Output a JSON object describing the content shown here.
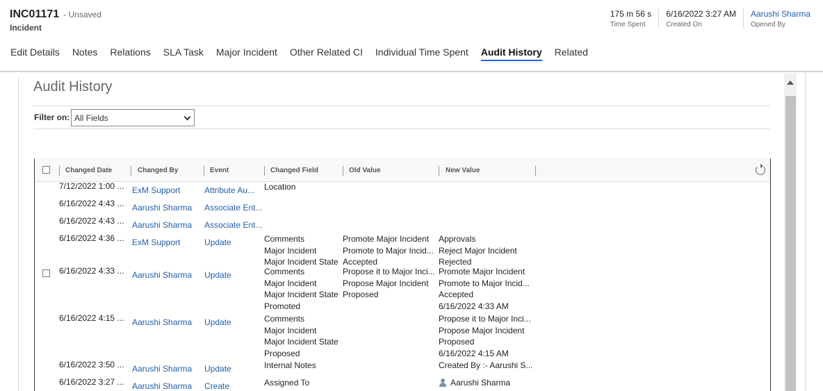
{
  "header": {
    "record_id": "INC01171",
    "save_status": "- Unsaved",
    "entity_type": "Incident",
    "fields": [
      {
        "value": "175 m 56 s",
        "label": "Time Spent"
      },
      {
        "value": "6/16/2022 3:27 AM",
        "label": "Created On"
      },
      {
        "value": "Aarushi Sharma",
        "label": "Opened By"
      }
    ]
  },
  "tabs": [
    {
      "label": "Edit Details"
    },
    {
      "label": "Notes"
    },
    {
      "label": "Relations"
    },
    {
      "label": "SLA Task"
    },
    {
      "label": "Major Incident"
    },
    {
      "label": "Other Related CI"
    },
    {
      "label": "Individual Time Spent"
    },
    {
      "label": "Audit History",
      "active": true
    },
    {
      "label": "Related"
    }
  ],
  "audit": {
    "title": "Audit History",
    "filter_label": "Filter on:",
    "filter_value": "All Fields",
    "columns": [
      "Changed Date",
      "Changed By",
      "Event",
      "Changed Field",
      "Old Value",
      "New Value"
    ],
    "rows": [
      {
        "date": "7/12/2022 1:00 ...",
        "by": "ExM Support",
        "event": "Attribute Au...",
        "fields": [
          "Location"
        ],
        "old": [],
        "new": []
      },
      {
        "date": "6/16/2022 4:43 ...",
        "by": "Aarushi Sharma",
        "event": "Associate Ent...",
        "fields": [],
        "old": [],
        "new": []
      },
      {
        "date": "6/16/2022 4:43 ...",
        "by": "Aarushi Sharma",
        "event": "Associate Ent...",
        "fields": [],
        "old": [],
        "new": []
      },
      {
        "date": "6/16/2022 4:36 ...",
        "by": "ExM Support",
        "event": "Update",
        "fields": [
          "Comments",
          "Major Incident",
          "Major Incident State"
        ],
        "old": [
          "Promote Major Incident",
          "Promote to Major Incid...",
          "Accepted"
        ],
        "new": [
          "Approvals",
          "Reject Major Incident",
          "Rejected"
        ]
      },
      {
        "date": "6/16/2022 4:33 ...",
        "by": "Aarushi Sharma",
        "event": "Update",
        "fields": [
          "Comments",
          "Major Incident",
          "Major Incident State",
          "Promoted"
        ],
        "old": [
          "Propose it to Major Inci...",
          "Propose Major Incident",
          "Proposed"
        ],
        "new": [
          "Promote Major Incident",
          "Promote to Major Incid...",
          "Accepted",
          "6/16/2022 4:33 AM"
        ]
      },
      {
        "date": "6/16/2022 4:15 ...",
        "by": "Aarushi Sharma",
        "event": "Update",
        "fields": [
          "Comments",
          "Major Incident",
          "Major Incident State",
          "Proposed"
        ],
        "old": [],
        "new": [
          "Propose it to Major Inci...",
          "Propose Major Incident",
          "Proposed",
          "6/16/2022 4:15 AM"
        ]
      },
      {
        "date": "6/16/2022 3:50 ...",
        "by": "Aarushi Sharma",
        "event": "Update",
        "fields": [
          "Internal Notes"
        ],
        "old": [],
        "new": [
          "Created By :- Aarushi S..."
        ]
      },
      {
        "date": "6/16/2022 3:27 ...",
        "by": "Aarushi Sharma",
        "event": "Create",
        "fields": [
          "Assigned To"
        ],
        "old": [],
        "new": [
          "Aarushi Sharma"
        ]
      }
    ]
  },
  "icons": {
    "header_checkbox": "checkbox-icon",
    "refresh": "refresh-icon",
    "user": "user-icon",
    "scroll_up": "scroll-up-arrow-icon"
  },
  "colors": {
    "link": "#1f5fa8",
    "tab_underline": "#2266e3"
  }
}
